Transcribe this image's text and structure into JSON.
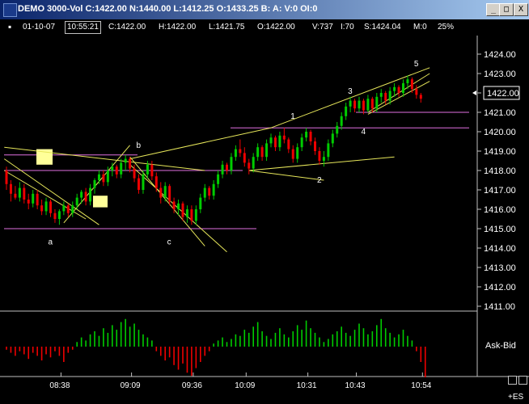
{
  "window": {
    "title": "DEMO 3000-Vol C:1422.00 N:1440.00 L:1412.25 O:1433.25 B: A: V:0 OI:0",
    "buttons": [
      "_",
      "□",
      "X"
    ]
  },
  "infobar": {
    "date": "01-10-07",
    "time": "10:55:21",
    "close": "C:1422.00",
    "high": "H:1422.00",
    "low": "L:1421.75",
    "open": "O:1422.00",
    "volume": "V:737",
    "interval": "I:70",
    "s": "S:1424.04",
    "m": "M:0",
    "pct": "25%"
  },
  "symbol_label": "+ES",
  "colors": {
    "up": "#00cc00",
    "down": "#ee0000",
    "trendline": "#e6e65a",
    "level": "#e070e0",
    "highlight": "#ffff99",
    "grid": "#ffffff",
    "axis": "#c0c0c0"
  },
  "chart_data": [
    {
      "type": "candlestick",
      "title": "",
      "ylim": [
        1411,
        1424.5
      ],
      "y_ticks": [
        1411,
        1412,
        1413,
        1414,
        1415,
        1416,
        1417,
        1418,
        1419,
        1420,
        1421,
        1422,
        1423,
        1424
      ],
      "y_tick_labels": [
        "1411.00",
        "1412.00",
        "1413.00",
        "1414.00",
        "1415.00",
        "1416.00",
        "1417.00",
        "1418.00",
        "1419.00",
        "1420.00",
        "1421.00",
        "1422.00",
        "1423.00",
        "1424.00"
      ],
      "x_ticks": [
        "08:38",
        "09:09",
        "09:36",
        "10:09",
        "10:31",
        "10:43",
        "10:54"
      ],
      "last_price": "1422.00",
      "wave_labels": [
        "a",
        "b",
        "c",
        "1",
        "2",
        "3",
        "4",
        "5"
      ],
      "horizontal_levels": [
        1415.0,
        1418.0,
        1418.8,
        1420.2,
        1421.0
      ],
      "series": [
        {
          "values": [
            {
              "o": 1418.0,
              "h": 1418.2,
              "l": 1417.0,
              "c": 1417.3
            },
            {
              "o": 1417.3,
              "h": 1417.5,
              "l": 1416.4,
              "c": 1416.8
            },
            {
              "o": 1416.8,
              "h": 1417.2,
              "l": 1416.5,
              "c": 1416.6
            },
            {
              "o": 1416.6,
              "h": 1417.4,
              "l": 1416.4,
              "c": 1417.1
            },
            {
              "o": 1417.1,
              "h": 1417.3,
              "l": 1416.3,
              "c": 1416.5
            },
            {
              "o": 1416.5,
              "h": 1416.8,
              "l": 1416.0,
              "c": 1416.3
            },
            {
              "o": 1416.3,
              "h": 1417.0,
              "l": 1416.1,
              "c": 1416.8
            },
            {
              "o": 1416.8,
              "h": 1417.0,
              "l": 1416.0,
              "c": 1416.2
            },
            {
              "o": 1416.2,
              "h": 1416.5,
              "l": 1415.7,
              "c": 1415.9
            },
            {
              "o": 1415.9,
              "h": 1416.6,
              "l": 1415.7,
              "c": 1416.4
            },
            {
              "o": 1416.4,
              "h": 1416.5,
              "l": 1415.6,
              "c": 1415.8
            },
            {
              "o": 1415.8,
              "h": 1416.0,
              "l": 1415.3,
              "c": 1415.5
            },
            {
              "o": 1415.5,
              "h": 1416.0,
              "l": 1415.2,
              "c": 1415.9
            },
            {
              "o": 1415.9,
              "h": 1416.4,
              "l": 1415.7,
              "c": 1416.2
            },
            {
              "o": 1416.2,
              "h": 1416.3,
              "l": 1415.6,
              "c": 1415.8
            },
            {
              "o": 1415.8,
              "h": 1416.4,
              "l": 1415.6,
              "c": 1416.2
            },
            {
              "o": 1416.2,
              "h": 1416.8,
              "l": 1416.0,
              "c": 1416.6
            },
            {
              "o": 1416.6,
              "h": 1417.0,
              "l": 1416.3,
              "c": 1416.9
            },
            {
              "o": 1416.9,
              "h": 1417.1,
              "l": 1416.2,
              "c": 1416.4
            },
            {
              "o": 1416.4,
              "h": 1417.3,
              "l": 1416.2,
              "c": 1417.1
            },
            {
              "o": 1417.1,
              "h": 1417.6,
              "l": 1416.8,
              "c": 1417.5
            },
            {
              "o": 1417.5,
              "h": 1418.0,
              "l": 1417.3,
              "c": 1417.8
            },
            {
              "o": 1417.8,
              "h": 1418.0,
              "l": 1417.2,
              "c": 1417.4
            },
            {
              "o": 1417.4,
              "h": 1418.2,
              "l": 1417.2,
              "c": 1418.0
            },
            {
              "o": 1418.0,
              "h": 1418.4,
              "l": 1417.7,
              "c": 1418.2
            },
            {
              "o": 1418.2,
              "h": 1418.3,
              "l": 1417.6,
              "c": 1417.8
            },
            {
              "o": 1417.8,
              "h": 1418.6,
              "l": 1417.6,
              "c": 1418.4
            },
            {
              "o": 1418.4,
              "h": 1418.8,
              "l": 1418.0,
              "c": 1418.6
            },
            {
              "o": 1418.6,
              "h": 1418.7,
              "l": 1417.9,
              "c": 1418.1
            },
            {
              "o": 1418.1,
              "h": 1418.3,
              "l": 1417.4,
              "c": 1417.6
            },
            {
              "o": 1417.6,
              "h": 1417.8,
              "l": 1416.8,
              "c": 1417.0
            },
            {
              "o": 1417.0,
              "h": 1418.0,
              "l": 1416.8,
              "c": 1417.8
            },
            {
              "o": 1417.8,
              "h": 1418.5,
              "l": 1417.6,
              "c": 1418.3
            },
            {
              "o": 1418.3,
              "h": 1418.5,
              "l": 1417.5,
              "c": 1417.7
            },
            {
              "o": 1417.7,
              "h": 1417.9,
              "l": 1416.9,
              "c": 1417.1
            },
            {
              "o": 1417.1,
              "h": 1417.4,
              "l": 1416.3,
              "c": 1416.6
            },
            {
              "o": 1416.6,
              "h": 1417.4,
              "l": 1416.4,
              "c": 1417.2
            },
            {
              "o": 1417.2,
              "h": 1417.3,
              "l": 1416.2,
              "c": 1416.4
            },
            {
              "o": 1416.4,
              "h": 1416.6,
              "l": 1415.8,
              "c": 1416.0
            },
            {
              "o": 1416.0,
              "h": 1416.5,
              "l": 1415.7,
              "c": 1416.3
            },
            {
              "o": 1416.3,
              "h": 1416.4,
              "l": 1415.4,
              "c": 1415.6
            },
            {
              "o": 1415.6,
              "h": 1416.2,
              "l": 1415.3,
              "c": 1416.0
            },
            {
              "o": 1416.0,
              "h": 1416.2,
              "l": 1415.2,
              "c": 1415.4
            },
            {
              "o": 1415.4,
              "h": 1416.2,
              "l": 1415.2,
              "c": 1416.0
            },
            {
              "o": 1416.0,
              "h": 1416.8,
              "l": 1415.8,
              "c": 1416.6
            },
            {
              "o": 1416.6,
              "h": 1417.3,
              "l": 1416.4,
              "c": 1417.1
            },
            {
              "o": 1417.1,
              "h": 1417.2,
              "l": 1416.5,
              "c": 1416.7
            },
            {
              "o": 1416.7,
              "h": 1417.5,
              "l": 1416.5,
              "c": 1417.3
            },
            {
              "o": 1417.3,
              "h": 1418.0,
              "l": 1417.1,
              "c": 1417.8
            },
            {
              "o": 1417.8,
              "h": 1418.5,
              "l": 1417.6,
              "c": 1418.3
            },
            {
              "o": 1418.3,
              "h": 1418.4,
              "l": 1417.8,
              "c": 1418.0
            },
            {
              "o": 1418.0,
              "h": 1418.9,
              "l": 1417.8,
              "c": 1418.7
            },
            {
              "o": 1418.7,
              "h": 1419.3,
              "l": 1418.5,
              "c": 1419.1
            },
            {
              "o": 1419.1,
              "h": 1419.6,
              "l": 1418.7,
              "c": 1418.9
            },
            {
              "o": 1418.9,
              "h": 1419.2,
              "l": 1418.2,
              "c": 1418.4
            },
            {
              "o": 1418.4,
              "h": 1418.6,
              "l": 1417.8,
              "c": 1418.1
            },
            {
              "o": 1418.1,
              "h": 1418.9,
              "l": 1417.9,
              "c": 1418.7
            },
            {
              "o": 1418.7,
              "h": 1419.4,
              "l": 1418.5,
              "c": 1419.2
            },
            {
              "o": 1419.2,
              "h": 1419.3,
              "l": 1418.5,
              "c": 1418.7
            },
            {
              "o": 1418.7,
              "h": 1419.6,
              "l": 1418.5,
              "c": 1419.4
            },
            {
              "o": 1419.4,
              "h": 1419.9,
              "l": 1419.2,
              "c": 1419.7
            },
            {
              "o": 1419.7,
              "h": 1419.8,
              "l": 1419.0,
              "c": 1419.2
            },
            {
              "o": 1419.2,
              "h": 1420.0,
              "l": 1419.0,
              "c": 1419.8
            },
            {
              "o": 1419.8,
              "h": 1420.2,
              "l": 1419.4,
              "c": 1419.6
            },
            {
              "o": 1419.6,
              "h": 1419.7,
              "l": 1418.9,
              "c": 1419.1
            },
            {
              "o": 1419.1,
              "h": 1419.3,
              "l": 1418.4,
              "c": 1418.6
            },
            {
              "o": 1418.6,
              "h": 1419.4,
              "l": 1418.4,
              "c": 1419.2
            },
            {
              "o": 1419.2,
              "h": 1419.9,
              "l": 1419.0,
              "c": 1419.7
            },
            {
              "o": 1419.7,
              "h": 1420.2,
              "l": 1419.5,
              "c": 1420.0
            },
            {
              "o": 1420.0,
              "h": 1420.1,
              "l": 1419.3,
              "c": 1419.5
            },
            {
              "o": 1419.5,
              "h": 1419.7,
              "l": 1418.8,
              "c": 1419.0
            },
            {
              "o": 1419.0,
              "h": 1419.2,
              "l": 1418.3,
              "c": 1418.5
            },
            {
              "o": 1418.5,
              "h": 1419.0,
              "l": 1418.2,
              "c": 1418.7
            },
            {
              "o": 1418.7,
              "h": 1419.6,
              "l": 1418.5,
              "c": 1419.4
            },
            {
              "o": 1419.4,
              "h": 1420.1,
              "l": 1419.2,
              "c": 1419.9
            },
            {
              "o": 1419.9,
              "h": 1420.5,
              "l": 1419.7,
              "c": 1420.3
            },
            {
              "o": 1420.3,
              "h": 1421.0,
              "l": 1420.1,
              "c": 1420.8
            },
            {
              "o": 1420.8,
              "h": 1421.5,
              "l": 1420.6,
              "c": 1421.3
            },
            {
              "o": 1421.3,
              "h": 1421.8,
              "l": 1421.0,
              "c": 1421.6
            },
            {
              "o": 1421.6,
              "h": 1421.7,
              "l": 1421.0,
              "c": 1421.2
            },
            {
              "o": 1421.2,
              "h": 1421.8,
              "l": 1421.0,
              "c": 1421.6
            },
            {
              "o": 1421.6,
              "h": 1421.7,
              "l": 1420.9,
              "c": 1421.1
            },
            {
              "o": 1421.1,
              "h": 1421.9,
              "l": 1421.0,
              "c": 1421.7
            },
            {
              "o": 1421.7,
              "h": 1421.8,
              "l": 1421.0,
              "c": 1421.2
            },
            {
              "o": 1421.2,
              "h": 1422.0,
              "l": 1421.0,
              "c": 1421.8
            },
            {
              "o": 1421.8,
              "h": 1422.2,
              "l": 1421.5,
              "c": 1422.0
            },
            {
              "o": 1422.0,
              "h": 1422.1,
              "l": 1421.4,
              "c": 1421.6
            },
            {
              "o": 1421.6,
              "h": 1422.3,
              "l": 1421.4,
              "c": 1422.1
            },
            {
              "o": 1422.1,
              "h": 1422.5,
              "l": 1421.8,
              "c": 1422.3
            },
            {
              "o": 1422.3,
              "h": 1422.4,
              "l": 1421.8,
              "c": 1422.0
            },
            {
              "o": 1422.0,
              "h": 1422.7,
              "l": 1421.8,
              "c": 1422.5
            },
            {
              "o": 1422.5,
              "h": 1422.9,
              "l": 1422.2,
              "c": 1422.7
            },
            {
              "o": 1422.7,
              "h": 1422.8,
              "l": 1422.0,
              "c": 1422.2
            },
            {
              "o": 1422.2,
              "h": 1422.4,
              "l": 1421.7,
              "c": 1421.9
            },
            {
              "o": 1421.9,
              "h": 1422.0,
              "l": 1421.5,
              "c": 1421.7
            }
          ]
        }
      ]
    },
    {
      "type": "bar",
      "title": "Ask-Bid",
      "values": [
        -2,
        -4,
        -6,
        -3,
        -5,
        -8,
        -4,
        -6,
        -9,
        -5,
        -7,
        -3,
        -6,
        -10,
        -4,
        -2,
        3,
        6,
        4,
        8,
        10,
        7,
        12,
        9,
        14,
        11,
        16,
        18,
        13,
        15,
        11,
        8,
        6,
        4,
        -3,
        -6,
        -9,
        -7,
        -12,
        -15,
        -11,
        -17,
        -19,
        -14,
        -10,
        -6,
        -3,
        2,
        4,
        6,
        3,
        5,
        8,
        7,
        11,
        9,
        13,
        16,
        10,
        7,
        5,
        9,
        12,
        8,
        6,
        10,
        14,
        11,
        17,
        12,
        9,
        6,
        3,
        5,
        8,
        10,
        13,
        9,
        7,
        11,
        15,
        12,
        8,
        10,
        14,
        18,
        12,
        9,
        6,
        8,
        11,
        7,
        4,
        -3,
        -10,
        -20
      ]
    }
  ]
}
